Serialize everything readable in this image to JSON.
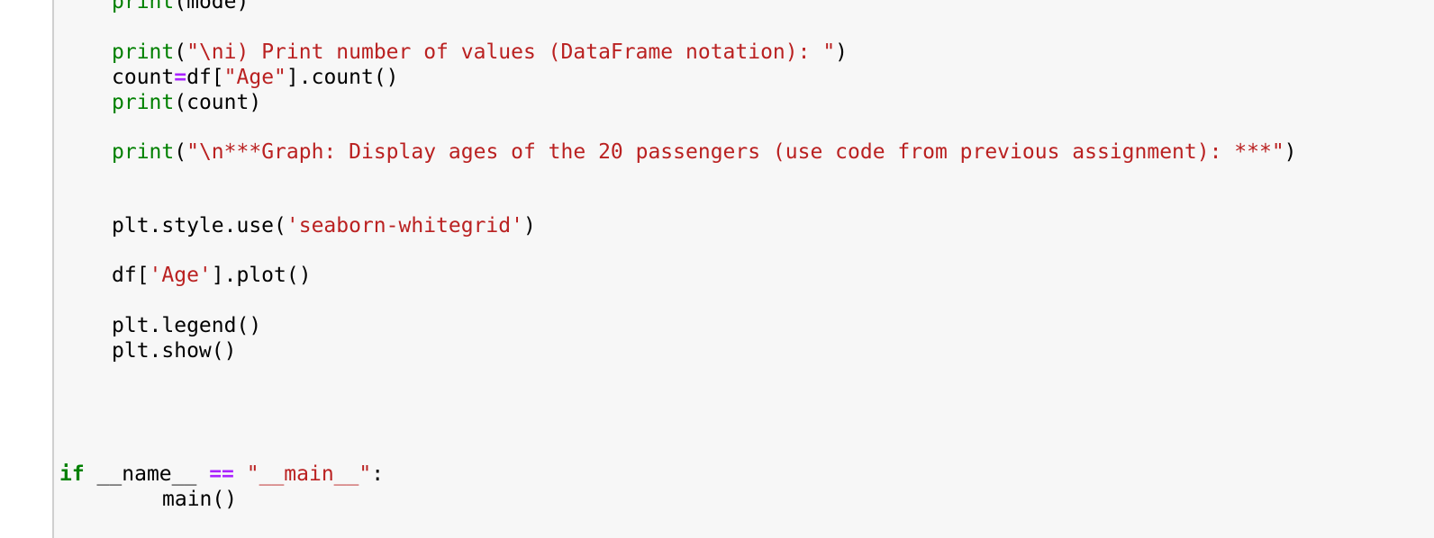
{
  "editor": {
    "lines": {
      "l0": {
        "fn": "print",
        "rest": "(mode)"
      },
      "l1": {
        "fn": "print",
        "open": "(",
        "str": "\"\\ni) Print number of values (DataFrame notation): \"",
        "close": ")"
      },
      "l2": {
        "var": "count",
        "op": "=",
        "pre": "df[",
        "str": "\"Age\"",
        "post": "].count()"
      },
      "l3": {
        "fn": "print",
        "rest": "(count)"
      },
      "l4": {
        "fn": "print",
        "open": "(",
        "str": "\"\\n***Graph: Display ages of the 20 passengers (use code from previous assignment): ***\"",
        "close": ")"
      },
      "l5": {
        "pre": "plt.style.use(",
        "str": "'seaborn-whitegrid'",
        "post": ")"
      },
      "l6": {
        "pre": "df[",
        "str": "'Age'",
        "post": "].plot()"
      },
      "l7": {
        "text": "plt.legend()"
      },
      "l8": {
        "text": "plt.show()"
      },
      "l9": {
        "kw": "if",
        "name": " __name__ ",
        "op": "==",
        "space": " ",
        "str": "\"__main__\"",
        "post": ":"
      },
      "l10": {
        "text": "main()"
      }
    }
  }
}
